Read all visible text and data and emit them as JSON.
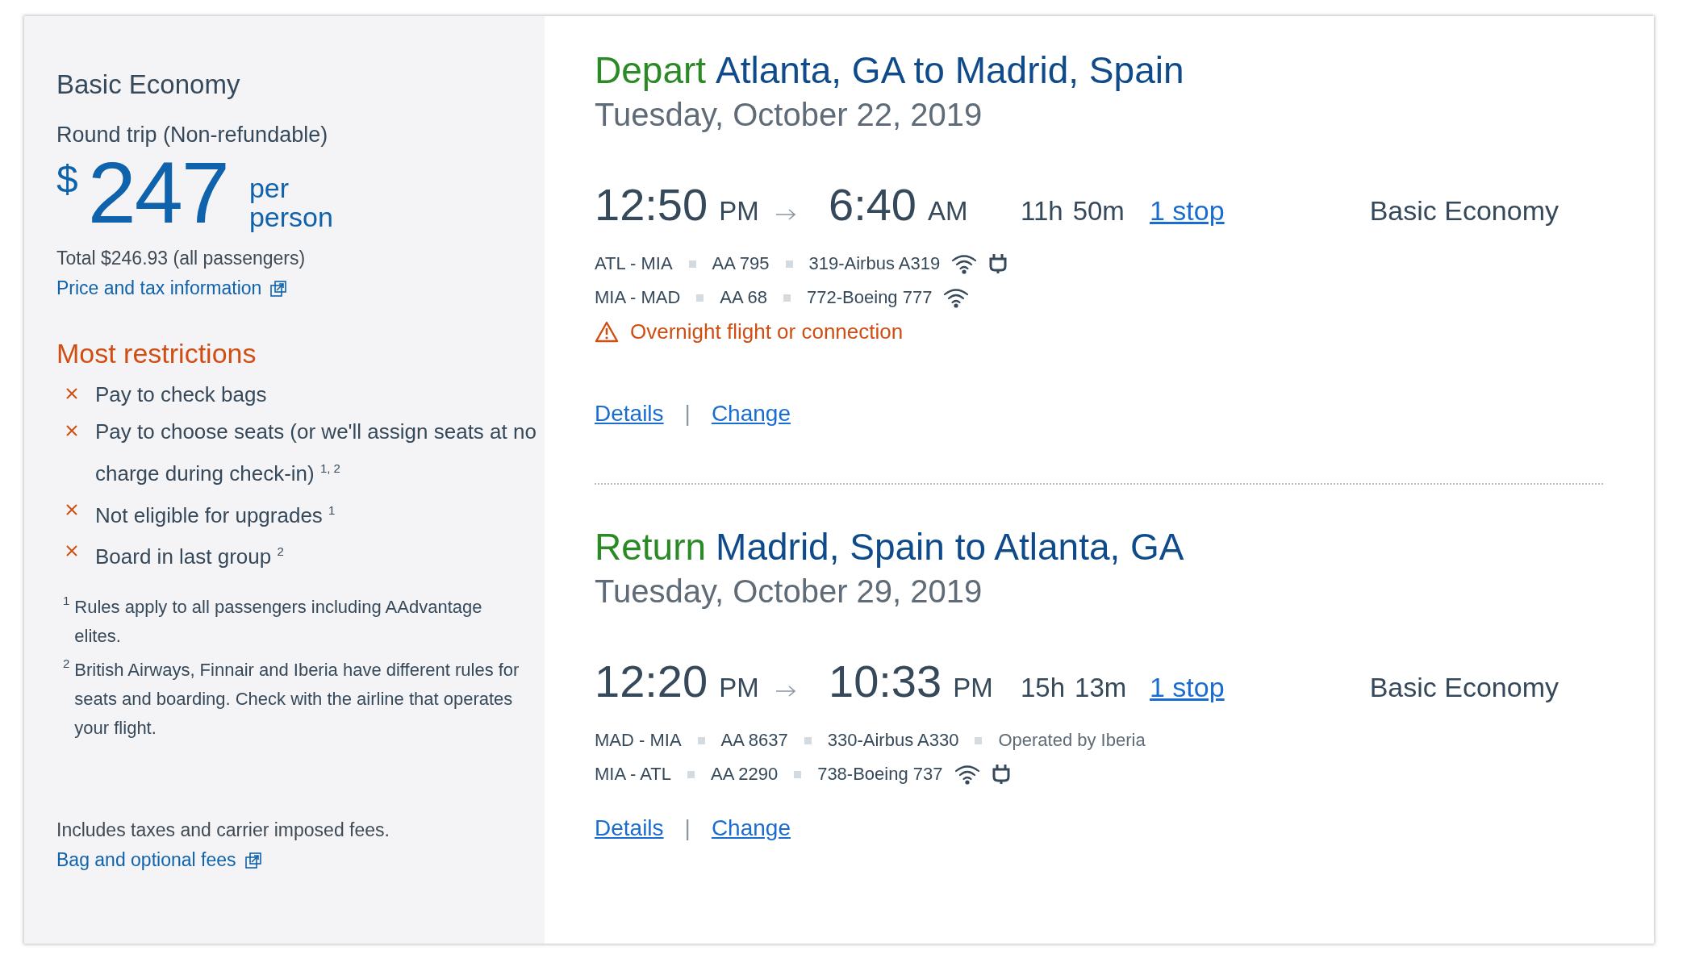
{
  "fare": {
    "title": "Basic Economy",
    "trip": "Round trip (Non-refundable)",
    "currency": "$",
    "price": "247",
    "per": "per",
    "person": "person",
    "total": "Total $246.93 (all passengers)",
    "price_link": "Price and tax information"
  },
  "restrictions": {
    "title": "Most restrictions",
    "items": [
      {
        "text": "Pay to check bags"
      },
      {
        "text": "Pay to choose seats (or we'll assign seats at no charge during check-in) $^{1, 2}$"
      },
      {
        "text": "Not eligible for upgrades $^{1}$"
      },
      {
        "text": "Board in last group $^{2}$"
      }
    ]
  },
  "footnotes": [
    {
      "mark": "1",
      "text": "Rules apply to all passengers including AAdvantage elites."
    },
    {
      "mark": "2",
      "text": "British Airways, Finnair and Iberia have different rules for seats and boarding. Check with the airline that operates your flight."
    }
  ],
  "fees_note": "Includes taxes and carrier imposed fees.",
  "fees_link": "Bag and optional fees",
  "slices": [
    {
      "label": "Depart",
      "route": "Atlanta, GA to Madrid, Spain",
      "date": "Tuesday, October 22, 2019",
      "depart_time": "12:50",
      "depart_period": "PM",
      "arrive_time": "6:40",
      "arrive_period": "AM",
      "duration_hours": "11h",
      "duration_minutes": "50m",
      "stops": "1 stop",
      "cabin": "Basic Economy",
      "segments": [
        {
          "route": "ATL - MIA",
          "flight": "AA 795",
          "aircraft": "319-Airbus A319",
          "wifi": true,
          "power": true
        },
        {
          "route": "MIA - MAD",
          "flight": "AA 68",
          "aircraft": "772-Boeing 777",
          "wifi": true,
          "power": false
        }
      ],
      "warning": "Overnight flight or connection",
      "details": "Details",
      "separator": "|",
      "change": "Change"
    },
    {
      "label": "Return",
      "route": "Madrid, Spain to Atlanta, GA",
      "date": "Tuesday, October 29, 2019",
      "depart_time": "12:20",
      "depart_period": "PM",
      "arrive_time": "10:33",
      "arrive_period": "PM",
      "duration_hours": "15h",
      "duration_minutes": "13m",
      "stops": "1 stop",
      "cabin": "Basic Economy",
      "segments": [
        {
          "route": "MAD - MIA",
          "flight": "AA 8637",
          "aircraft": "330-Airbus A330",
          "operator": "Operated by Iberia",
          "wifi": false,
          "power": false
        },
        {
          "route": "MIA - ATL",
          "flight": "AA 2290",
          "aircraft": "738-Boeing 737",
          "wifi": true,
          "power": true
        }
      ],
      "details": "Details",
      "separator": "|",
      "change": "Change"
    }
  ]
}
